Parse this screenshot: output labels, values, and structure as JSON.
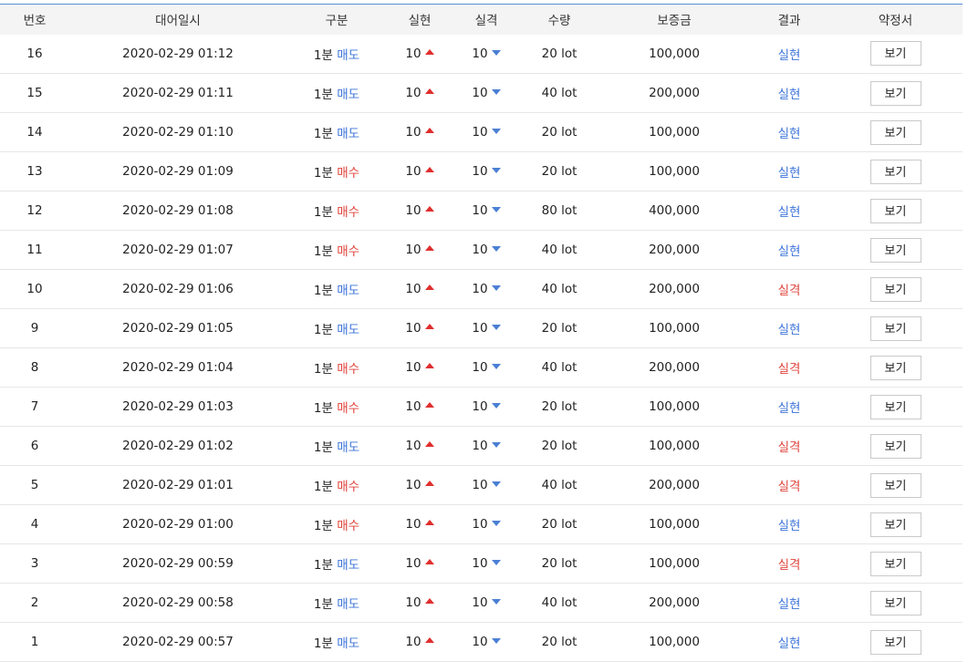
{
  "headers": [
    "번호",
    "대어일시",
    "구분",
    "실현",
    "실격",
    "수량",
    "보증금",
    "결과",
    "약정서"
  ],
  "colors": {
    "blue": "#3d74d9",
    "red": "#e0433b",
    "up_arrow": "#e02e2e",
    "down_arrow": "#4a7fd4"
  },
  "icons": {
    "up": "caret-up-icon",
    "down": "caret-down-icon"
  },
  "rows": [
    {
      "no": "16",
      "datetime": "2020-02-29 01:12",
      "period": "1분",
      "type": "매도",
      "type_color": "blue",
      "up": "10",
      "down": "10",
      "qty": "20 lot",
      "deposit": "100,000",
      "result": "실현",
      "result_color": "blue",
      "btn": "보기"
    },
    {
      "no": "15",
      "datetime": "2020-02-29 01:11",
      "period": "1분",
      "type": "매도",
      "type_color": "blue",
      "up": "10",
      "down": "10",
      "qty": "40 lot",
      "deposit": "200,000",
      "result": "실현",
      "result_color": "blue",
      "btn": "보기"
    },
    {
      "no": "14",
      "datetime": "2020-02-29 01:10",
      "period": "1분",
      "type": "매도",
      "type_color": "blue",
      "up": "10",
      "down": "10",
      "qty": "20 lot",
      "deposit": "100,000",
      "result": "실현",
      "result_color": "blue",
      "btn": "보기"
    },
    {
      "no": "13",
      "datetime": "2020-02-29 01:09",
      "period": "1분",
      "type": "매수",
      "type_color": "red",
      "up": "10",
      "down": "10",
      "qty": "20 lot",
      "deposit": "100,000",
      "result": "실현",
      "result_color": "blue",
      "btn": "보기"
    },
    {
      "no": "12",
      "datetime": "2020-02-29 01:08",
      "period": "1분",
      "type": "매수",
      "type_color": "red",
      "up": "10",
      "down": "10",
      "qty": "80 lot",
      "deposit": "400,000",
      "result": "실현",
      "result_color": "blue",
      "btn": "보기"
    },
    {
      "no": "11",
      "datetime": "2020-02-29 01:07",
      "period": "1분",
      "type": "매수",
      "type_color": "red",
      "up": "10",
      "down": "10",
      "qty": "40 lot",
      "deposit": "200,000",
      "result": "실현",
      "result_color": "blue",
      "btn": "보기"
    },
    {
      "no": "10",
      "datetime": "2020-02-29 01:06",
      "period": "1분",
      "type": "매도",
      "type_color": "blue",
      "up": "10",
      "down": "10",
      "qty": "40 lot",
      "deposit": "200,000",
      "result": "실격",
      "result_color": "red",
      "btn": "보기"
    },
    {
      "no": "9",
      "datetime": "2020-02-29 01:05",
      "period": "1분",
      "type": "매도",
      "type_color": "blue",
      "up": "10",
      "down": "10",
      "qty": "20 lot",
      "deposit": "100,000",
      "result": "실현",
      "result_color": "blue",
      "btn": "보기"
    },
    {
      "no": "8",
      "datetime": "2020-02-29 01:04",
      "period": "1분",
      "type": "매수",
      "type_color": "red",
      "up": "10",
      "down": "10",
      "qty": "40 lot",
      "deposit": "200,000",
      "result": "실격",
      "result_color": "red",
      "btn": "보기"
    },
    {
      "no": "7",
      "datetime": "2020-02-29 01:03",
      "period": "1분",
      "type": "매수",
      "type_color": "red",
      "up": "10",
      "down": "10",
      "qty": "20 lot",
      "deposit": "100,000",
      "result": "실현",
      "result_color": "blue",
      "btn": "보기"
    },
    {
      "no": "6",
      "datetime": "2020-02-29 01:02",
      "period": "1분",
      "type": "매도",
      "type_color": "blue",
      "up": "10",
      "down": "10",
      "qty": "20 lot",
      "deposit": "100,000",
      "result": "실격",
      "result_color": "red",
      "btn": "보기"
    },
    {
      "no": "5",
      "datetime": "2020-02-29 01:01",
      "period": "1분",
      "type": "매수",
      "type_color": "red",
      "up": "10",
      "down": "10",
      "qty": "40 lot",
      "deposit": "200,000",
      "result": "실격",
      "result_color": "red",
      "btn": "보기"
    },
    {
      "no": "4",
      "datetime": "2020-02-29 01:00",
      "period": "1분",
      "type": "매수",
      "type_color": "red",
      "up": "10",
      "down": "10",
      "qty": "20 lot",
      "deposit": "100,000",
      "result": "실현",
      "result_color": "blue",
      "btn": "보기"
    },
    {
      "no": "3",
      "datetime": "2020-02-29 00:59",
      "period": "1분",
      "type": "매도",
      "type_color": "blue",
      "up": "10",
      "down": "10",
      "qty": "20 lot",
      "deposit": "100,000",
      "result": "실격",
      "result_color": "red",
      "btn": "보기"
    },
    {
      "no": "2",
      "datetime": "2020-02-29 00:58",
      "period": "1분",
      "type": "매도",
      "type_color": "blue",
      "up": "10",
      "down": "10",
      "qty": "40 lot",
      "deposit": "200,000",
      "result": "실현",
      "result_color": "blue",
      "btn": "보기"
    },
    {
      "no": "1",
      "datetime": "2020-02-29 00:57",
      "period": "1분",
      "type": "매도",
      "type_color": "blue",
      "up": "10",
      "down": "10",
      "qty": "20 lot",
      "deposit": "100,000",
      "result": "실현",
      "result_color": "blue",
      "btn": "보기"
    }
  ]
}
